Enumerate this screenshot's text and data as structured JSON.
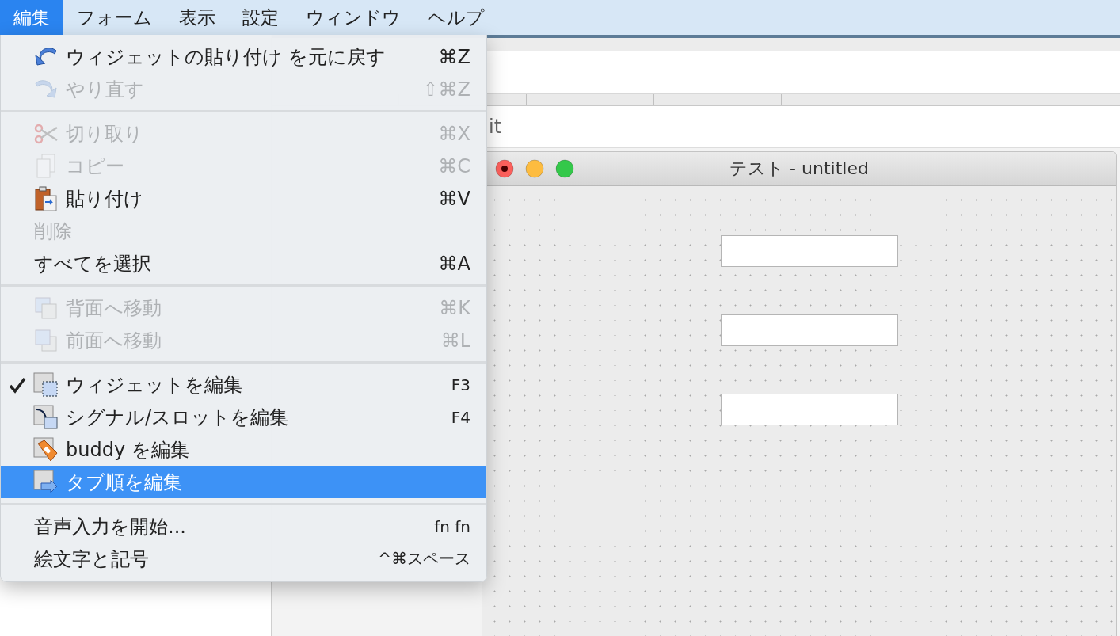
{
  "menubar": [
    {
      "label": "編集",
      "selected": true
    },
    {
      "label": "フォーム",
      "selected": false
    },
    {
      "label": "表示",
      "selected": false
    },
    {
      "label": "設定",
      "selected": false
    },
    {
      "label": "ウィンドウ",
      "selected": false
    },
    {
      "label": "ヘルプ",
      "selected": false
    }
  ],
  "menu": {
    "groups": [
      {
        "items": [
          {
            "label": "ウィジェットの貼り付け を元に戻す",
            "shortcut": "⌘Z",
            "disabled": false,
            "checked": false,
            "selected": false
          },
          {
            "label": "やり直す",
            "shortcut": "⇧⌘Z",
            "disabled": true,
            "checked": false,
            "selected": false
          }
        ]
      },
      {
        "items": [
          {
            "label": "切り取り",
            "shortcut": "⌘X",
            "disabled": true,
            "checked": false,
            "selected": false
          },
          {
            "label": "コピー",
            "shortcut": "⌘C",
            "disabled": true,
            "checked": false,
            "selected": false
          },
          {
            "label": "貼り付け",
            "shortcut": "⌘V",
            "disabled": false,
            "checked": false,
            "selected": false
          },
          {
            "label": "削除",
            "disabled": true,
            "checked": false,
            "selected": false
          },
          {
            "label": "すべてを選択",
            "shortcut": "⌘A",
            "disabled": false,
            "checked": false,
            "selected": false
          }
        ]
      },
      {
        "items": [
          {
            "label": "背面へ移動",
            "shortcut": "⌘K",
            "disabled": true,
            "checked": false,
            "selected": false
          },
          {
            "label": "前面へ移動",
            "shortcut": "⌘L",
            "disabled": true,
            "checked": false,
            "selected": false
          }
        ]
      },
      {
        "items": [
          {
            "label": "ウィジェットを編集",
            "shortcut": "F3",
            "disabled": false,
            "checked": true,
            "selected": false
          },
          {
            "label": "シグナル/スロットを編集",
            "shortcut": "F4",
            "disabled": false,
            "checked": false,
            "selected": false
          },
          {
            "label": "buddy を編集",
            "disabled": false,
            "checked": false,
            "selected": false
          },
          {
            "label": "タブ順を編集",
            "disabled": false,
            "checked": false,
            "selected": true
          }
        ]
      },
      {
        "items": [
          {
            "label": "音声入力を開始...",
            "shortcut": "fn fn",
            "disabled": false,
            "checked": false,
            "selected": false
          },
          {
            "label": "絵文字と記号",
            "shortcut": "^⌘スペース",
            "disabled": false,
            "checked": false,
            "selected": false
          }
        ]
      }
    ]
  },
  "background": {
    "partial_title": "it"
  },
  "form_window": {
    "title": "テスト - untitled",
    "fields": [
      {
        "kind": "line-edit"
      },
      {
        "kind": "line-edit"
      },
      {
        "kind": "line-edit"
      }
    ]
  }
}
